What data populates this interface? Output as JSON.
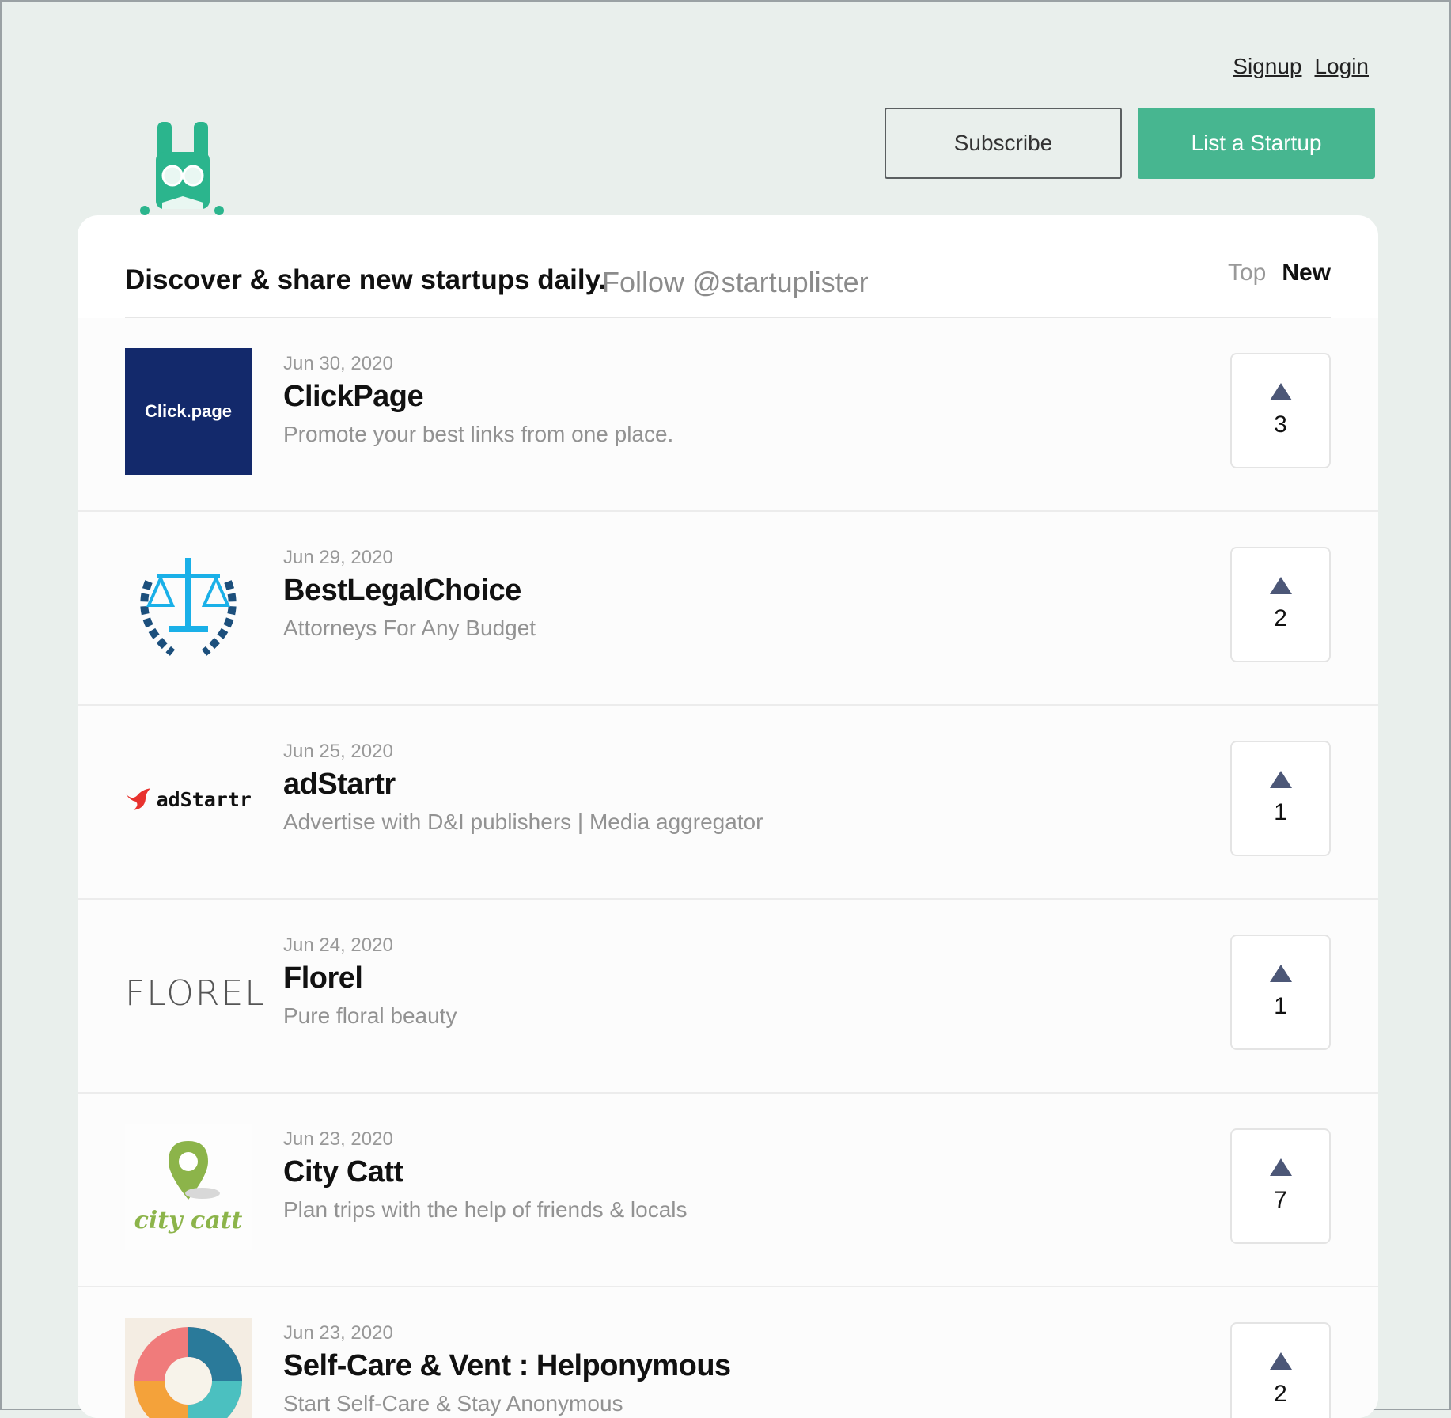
{
  "auth": {
    "signup": "Signup",
    "login": "Login"
  },
  "buttons": {
    "subscribe": "Subscribe",
    "list_startup": "List a Startup"
  },
  "header": {
    "tagline": "Discover & share new startups daily.",
    "follow": "Follow @startuplister",
    "sort_top": "Top",
    "sort_new": "New"
  },
  "colors": {
    "accent": "#47b690",
    "logo_bg": "#13296b",
    "arrow": "#4c5777"
  },
  "startups": [
    {
      "date": "Jun 30, 2020",
      "name": "ClickPage",
      "desc": "Promote your best links from one place.",
      "votes": "3",
      "logo": "click-page-logo",
      "logo_text": "Click.page"
    },
    {
      "date": "Jun 29, 2020",
      "name": "BestLegalChoice",
      "desc": "Attorneys For Any Budget",
      "votes": "2",
      "logo": "scales-logo"
    },
    {
      "date": "Jun 25, 2020",
      "name": "adStartr",
      "desc": "Advertise with D&I publishers | Media aggregator",
      "votes": "1",
      "logo": "adstartr-logo",
      "logo_text": "adStartr"
    },
    {
      "date": "Jun 24, 2020",
      "name": "Florel",
      "desc": "Pure floral beauty",
      "votes": "1",
      "logo": "florel-logo",
      "logo_text": "FLOREL"
    },
    {
      "date": "Jun 23, 2020",
      "name": "City Catt",
      "desc": "Plan trips with the help of friends & locals",
      "votes": "7",
      "logo": "city-catt-logo",
      "logo_text": "city catt"
    },
    {
      "date": "Jun 23, 2020",
      "name": "Self-Care & Vent : Helponymous",
      "desc": "Start Self-Care & Stay Anonymous",
      "votes": "2",
      "logo": "lifebuoy-logo"
    }
  ]
}
